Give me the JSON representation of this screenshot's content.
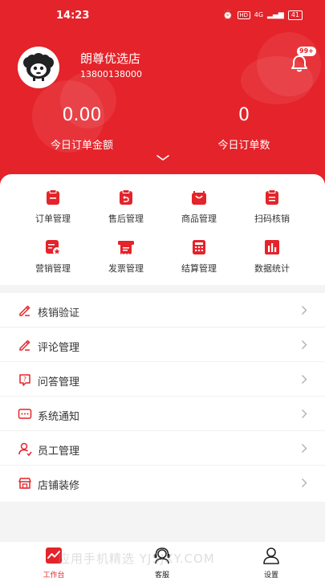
{
  "status_bar": {
    "time": "14:23",
    "hd": "HD",
    "signal": "4G",
    "battery": "41"
  },
  "profile": {
    "store_name": "朗尊优选店",
    "phone": "13800138000"
  },
  "notifications": {
    "badge": "99+"
  },
  "stats": [
    {
      "value": "0.00",
      "label": "今日订单金额"
    },
    {
      "value": "0",
      "label": "今日订单数"
    }
  ],
  "grid": [
    {
      "label": "订单管理",
      "icon": "order-icon"
    },
    {
      "label": "售后管理",
      "icon": "after-sales-icon"
    },
    {
      "label": "商品管理",
      "icon": "bag-icon"
    },
    {
      "label": "扫码核销",
      "icon": "scan-icon"
    },
    {
      "label": "营销管理",
      "icon": "marketing-icon"
    },
    {
      "label": "发票管理",
      "icon": "invoice-icon"
    },
    {
      "label": "结算管理",
      "icon": "calculator-icon"
    },
    {
      "label": "数据统计",
      "icon": "chart-icon"
    }
  ],
  "menu": [
    {
      "label": "核销验证",
      "icon": "verify-icon"
    },
    {
      "label": "评论管理",
      "icon": "comment-pen-icon"
    },
    {
      "label": "问答管理",
      "icon": "qa-icon"
    },
    {
      "label": "系统通知",
      "icon": "message-icon"
    },
    {
      "label": "员工管理",
      "icon": "staff-icon"
    },
    {
      "label": "店铺装修",
      "icon": "store-icon"
    }
  ],
  "tabs": [
    {
      "label": "工作台",
      "icon": "dashboard-icon",
      "active": true
    },
    {
      "label": "客服",
      "icon": "headset-icon",
      "active": false
    },
    {
      "label": "设置",
      "icon": "user-settings-icon",
      "active": false
    }
  ],
  "watermark": "应用手机精选 YJSJXY.COM",
  "colors": {
    "brand": "#e4232a",
    "text": "#333333",
    "muted": "#b0b0b0"
  }
}
